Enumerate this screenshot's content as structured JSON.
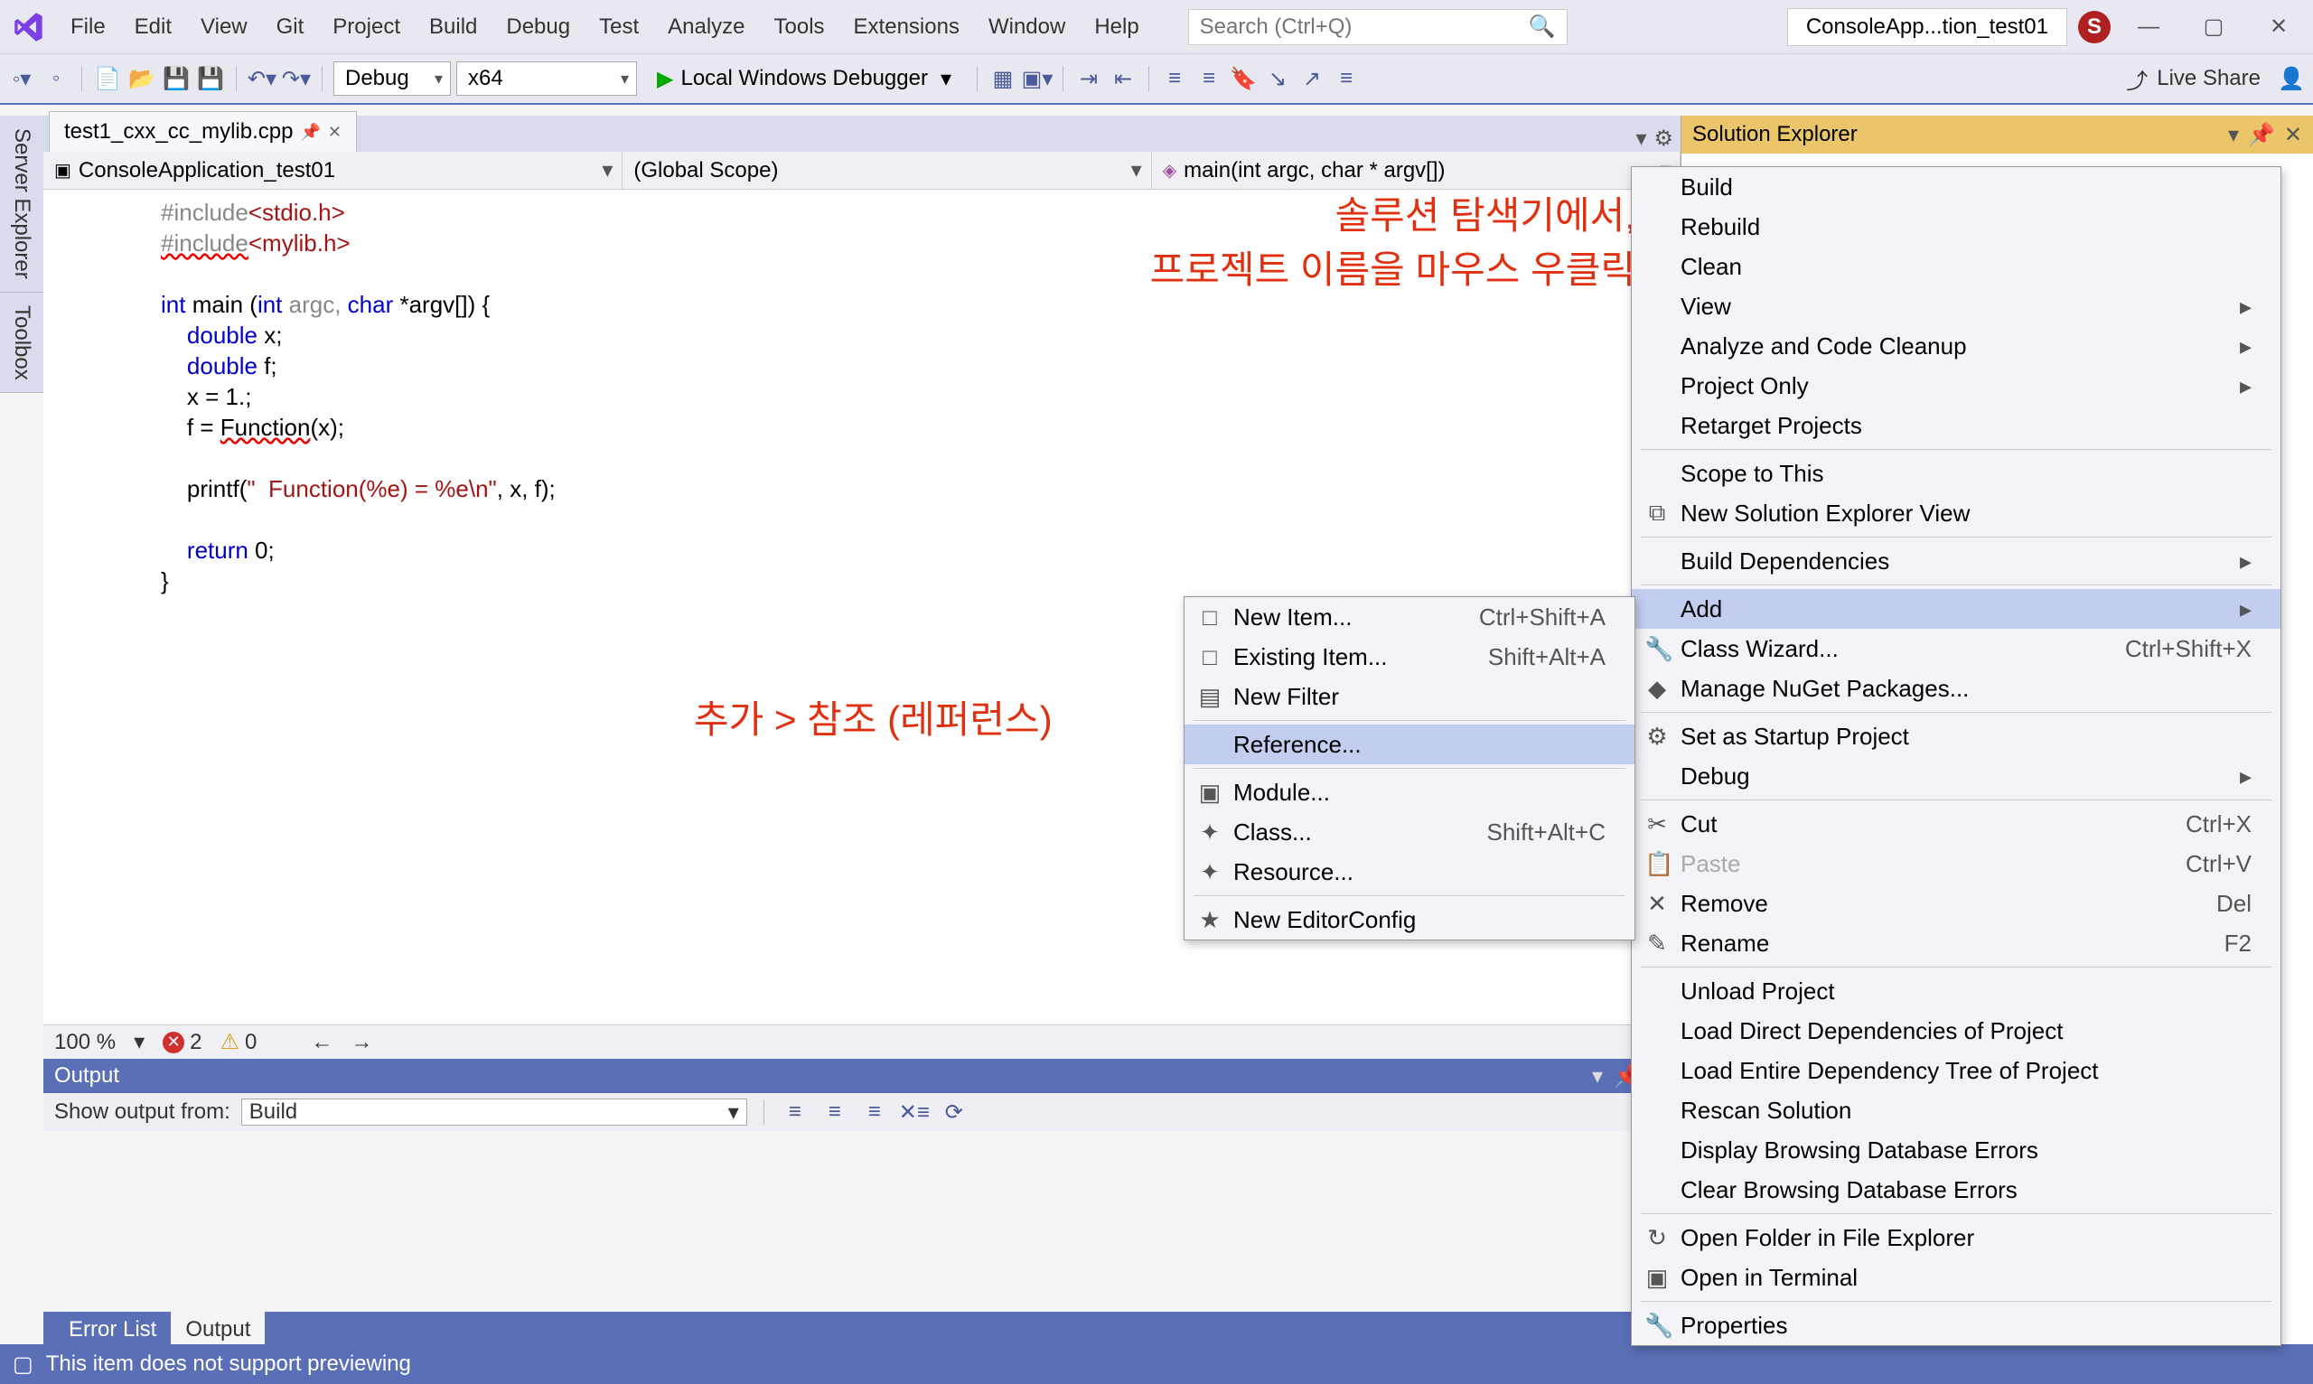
{
  "menubar": [
    "File",
    "Edit",
    "View",
    "Git",
    "Project",
    "Build",
    "Debug",
    "Test",
    "Analyze",
    "Tools",
    "Extensions",
    "Window",
    "Help"
  ],
  "search_placeholder": "Search (Ctrl+Q)",
  "project_pill": "ConsoleApp...tion_test01",
  "user_initial": "S",
  "toolbar": {
    "config": "Debug",
    "platform": "x64",
    "debugger": "Local Windows Debugger",
    "live_share": "Live Share"
  },
  "side_tabs": [
    "Server Explorer",
    "Toolbox"
  ],
  "doc_tab": "test1_cxx_cc_mylib.cpp",
  "ctx_bar": {
    "project": "ConsoleApplication_test01",
    "scope": "(Global Scope)",
    "func": "main(int argc, char * argv[])"
  },
  "code": {
    "l1a": "#include",
    "l1b": "<stdio.h>",
    "l2a": "#include",
    "l2b": "<mylib.h>",
    "l4a": "int",
    "l4b": " main (",
    "l4c": "int",
    "l4d": " argc, ",
    "l4e": "char",
    "l4f": " *argv[]) {",
    "l5a": "    ",
    "l5b": "double",
    "l5c": " x;",
    "l6a": "    ",
    "l6b": "double",
    "l6c": " f;",
    "l7": "    x = 1.;",
    "l8a": "    f = ",
    "l8b": "Function",
    "l8c": "(x);",
    "l10a": "    printf(",
    "l10b": "\"  Function(%e) = %e\\n\"",
    "l10c": ", x, f);",
    "l12a": "    ",
    "l12b": "return",
    "l12c": " 0;",
    "l13": "}"
  },
  "annotations": {
    "a1": "솔루션 탐색기에서,",
    "a2": "프로젝트 이름을 마우스 우클릭",
    "a3": "추가 > 참조 (레퍼런스)"
  },
  "ed_status": {
    "zoom": "100 %",
    "errors": "2",
    "warnings": "0"
  },
  "output": {
    "title": "Output",
    "show_from": "Show output from:",
    "source": "Build"
  },
  "bottom_tabs": {
    "err": "Error List",
    "out": "Output"
  },
  "statusbar_msg": "This item does not support previewing",
  "sol_title": "Solution Explorer",
  "main_menu": [
    {
      "label": "Build"
    },
    {
      "label": "Rebuild"
    },
    {
      "label": "Clean"
    },
    {
      "label": "View",
      "sub": true
    },
    {
      "label": "Analyze and Code Cleanup",
      "sub": true
    },
    {
      "label": "Project Only",
      "sub": true
    },
    {
      "label": "Retarget Projects"
    },
    {
      "sep": true
    },
    {
      "label": "Scope to This"
    },
    {
      "label": "New Solution Explorer View",
      "icon": "⧉"
    },
    {
      "sep": true
    },
    {
      "label": "Build Dependencies",
      "sub": true
    },
    {
      "sep": true
    },
    {
      "label": "Add",
      "sub": true,
      "hl": true
    },
    {
      "label": "Class Wizard...",
      "icon": "🔧",
      "shortcut": "Ctrl+Shift+X"
    },
    {
      "label": "Manage NuGet Packages...",
      "icon": "◆"
    },
    {
      "sep": true
    },
    {
      "label": "Set as Startup Project",
      "icon": "⚙"
    },
    {
      "label": "Debug",
      "sub": true
    },
    {
      "sep": true
    },
    {
      "label": "Cut",
      "icon": "✂",
      "shortcut": "Ctrl+X"
    },
    {
      "label": "Paste",
      "icon": "📋",
      "shortcut": "Ctrl+V",
      "disabled": true
    },
    {
      "label": "Remove",
      "icon": "✕",
      "shortcut": "Del"
    },
    {
      "label": "Rename",
      "icon": "✎",
      "shortcut": "F2"
    },
    {
      "sep": true
    },
    {
      "label": "Unload Project"
    },
    {
      "label": "Load Direct Dependencies of Project"
    },
    {
      "label": "Load Entire Dependency Tree of Project"
    },
    {
      "label": "Rescan Solution"
    },
    {
      "label": "Display Browsing Database Errors"
    },
    {
      "label": "Clear Browsing Database Errors"
    },
    {
      "sep": true
    },
    {
      "label": "Open Folder in File Explorer",
      "icon": "↻"
    },
    {
      "label": "Open in Terminal",
      "icon": "▣"
    },
    {
      "sep": true
    },
    {
      "label": "Properties",
      "icon": "🔧"
    }
  ],
  "sub_menu": [
    {
      "label": "New Item...",
      "icon": "□",
      "shortcut": "Ctrl+Shift+A"
    },
    {
      "label": "Existing Item...",
      "icon": "□",
      "shortcut": "Shift+Alt+A"
    },
    {
      "label": "New Filter",
      "icon": "▤"
    },
    {
      "sep": true
    },
    {
      "label": "Reference...",
      "hl": true
    },
    {
      "sep": true
    },
    {
      "label": "Module...",
      "icon": "▣"
    },
    {
      "label": "Class...",
      "icon": "✦",
      "shortcut": "Shift+Alt+C"
    },
    {
      "label": "Resource...",
      "icon": "✦"
    },
    {
      "sep": true
    },
    {
      "label": "New EditorConfig",
      "icon": "★"
    }
  ]
}
